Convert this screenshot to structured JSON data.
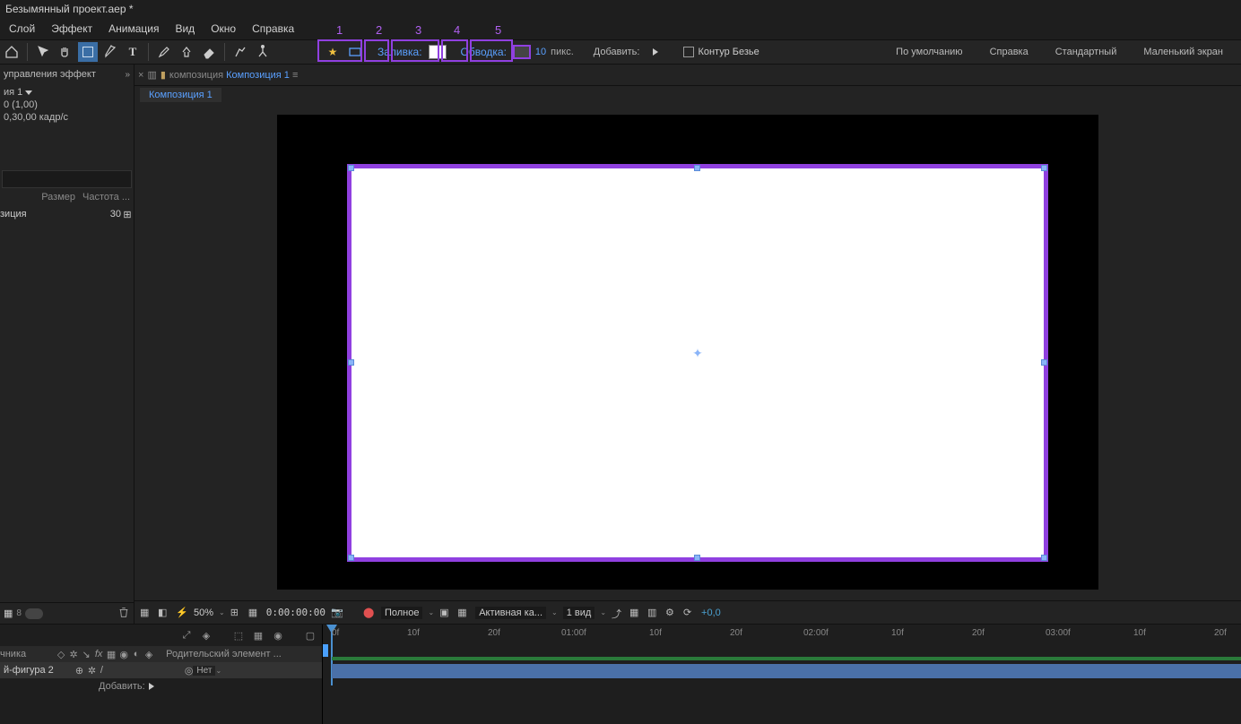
{
  "title": "Безымянный проект.aep *",
  "menu": [
    "Слой",
    "Эффект",
    "Анимация",
    "Вид",
    "Окно",
    "Справка"
  ],
  "shape_opts": {
    "fill_label": "Заливка:",
    "stroke_label": "Обводка:",
    "stroke_px": "10",
    "px_unit": "пикс.",
    "add_label": "Добавить:",
    "bezier_label": "Контур Безье"
  },
  "workspaces": [
    "По умолчанию",
    "Справка",
    "Стандартный",
    "Маленький экран"
  ],
  "effects_panel": "управления эффект",
  "project": {
    "comp": "ия 1",
    "line2": "0 (1,00)",
    "line3": "0,30,00 кадр/с",
    "headers": [
      "Размер",
      "Частота ..."
    ],
    "item": "зиция",
    "item_fps": "30",
    "bit_depth": "8"
  },
  "comp_crumb_pre": "композиция",
  "comp_crumb": "Композиция 1",
  "comp_tab": "Композиция 1",
  "viewer_footer": {
    "zoom": "50%",
    "time": "0:00:00:00",
    "quality": "Полное",
    "camera": "Активная ка...",
    "views": "1 вид",
    "exposure": "+0,0"
  },
  "timeline": {
    "header_src": "чника",
    "parent_col": "Родительский элемент ...",
    "layer_name": "й-фигура 2",
    "mode_none": "Нет",
    "add_label": "Добавить:",
    "ticks": [
      "0f",
      "10f",
      "20f",
      "01:00f",
      "10f",
      "20f",
      "02:00f",
      "10f",
      "20f",
      "03:00f",
      "10f",
      "20f"
    ]
  },
  "annots": [
    "1",
    "2",
    "3",
    "4",
    "5"
  ]
}
